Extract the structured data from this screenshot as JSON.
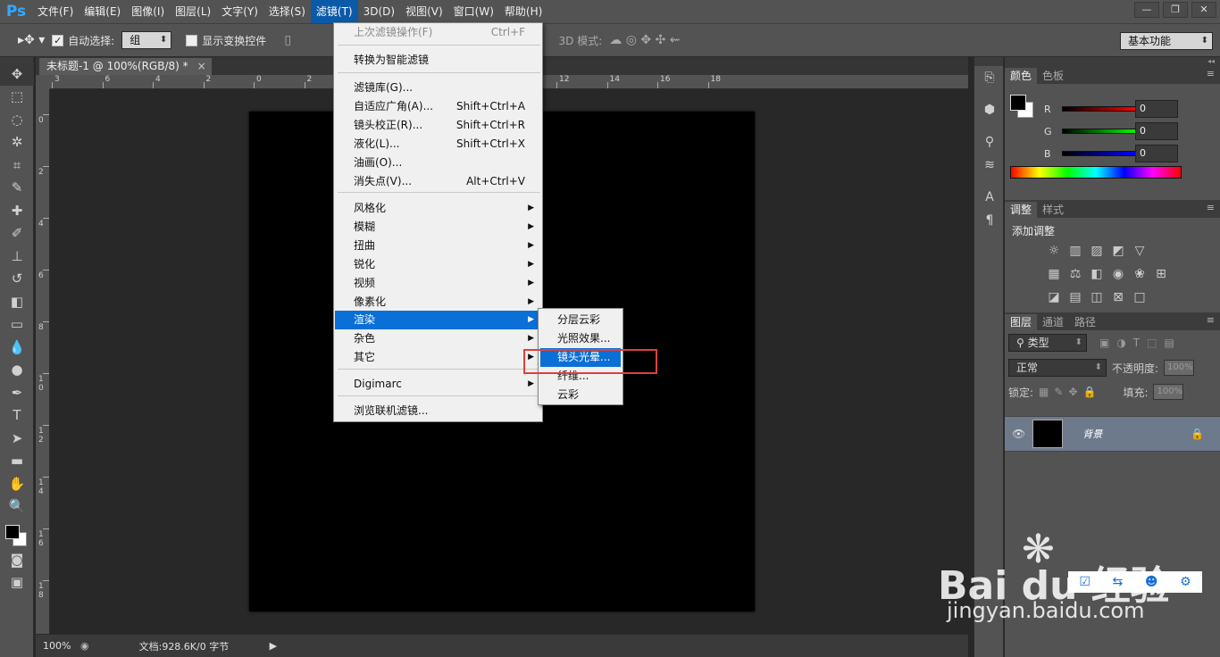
{
  "app": {
    "logo": "Ps"
  },
  "menubar": {
    "items": [
      "文件(F)",
      "编辑(E)",
      "图像(I)",
      "图层(L)",
      "文字(Y)",
      "选择(S)",
      "滤镜(T)",
      "3D(D)",
      "视图(V)",
      "窗口(W)",
      "帮助(H)"
    ],
    "active_index": 6,
    "window_controls": [
      "—",
      "❐",
      "✕"
    ]
  },
  "options": {
    "auto_select_label": "自动选择:",
    "auto_select_value": "组",
    "show_transform_label": "显示变换控件",
    "mode3d_label": "3D 模式:",
    "workspace": "基本功能"
  },
  "document": {
    "tab_title": "未标题-1 @ 100%(RGB/8) *",
    "close": "×",
    "ruler_top": [
      "3",
      "6",
      "4",
      "2",
      "0",
      "2",
      "4",
      "6",
      "8",
      "10",
      "12",
      "14",
      "16",
      "18"
    ],
    "ruler_left": [
      "0",
      "2",
      "4",
      "6",
      "8",
      "1\n0",
      "1\n2",
      "1\n4",
      "1\n6",
      "1\n8"
    ]
  },
  "status": {
    "zoom": "100%",
    "doc": "文档:928.6K/0 字节",
    "arrow": "▶"
  },
  "filter_menu": {
    "items": [
      {
        "label": "上次滤镜操作(F)",
        "shortcut": "Ctrl+F",
        "disabled": true
      },
      {
        "label": "转换为智能滤镜"
      },
      {
        "label": "滤镜库(G)..."
      },
      {
        "label": "自适应广角(A)...",
        "shortcut": "Shift+Ctrl+A"
      },
      {
        "label": "镜头校正(R)...",
        "shortcut": "Shift+Ctrl+R"
      },
      {
        "label": "液化(L)...",
        "shortcut": "Shift+Ctrl+X"
      },
      {
        "label": "油画(O)..."
      },
      {
        "label": "消失点(V)...",
        "shortcut": "Alt+Ctrl+V"
      },
      {
        "label": "风格化",
        "submenu": true
      },
      {
        "label": "模糊",
        "submenu": true
      },
      {
        "label": "扭曲",
        "submenu": true
      },
      {
        "label": "锐化",
        "submenu": true
      },
      {
        "label": "视频",
        "submenu": true
      },
      {
        "label": "像素化",
        "submenu": true
      },
      {
        "label": "渲染",
        "submenu": true,
        "highlighted": true
      },
      {
        "label": "杂色",
        "submenu": true
      },
      {
        "label": "其它",
        "submenu": true
      },
      {
        "label": "Digimarc",
        "submenu": true
      },
      {
        "label": "浏览联机滤镜..."
      }
    ]
  },
  "render_submenu": {
    "items": [
      "分层云彩",
      "光照效果...",
      "镜头光晕...",
      "纤维...",
      "云彩"
    ],
    "highlighted_index": 2
  },
  "panels": {
    "color_tabs": [
      "颜色",
      "色板"
    ],
    "rgb": [
      {
        "label": "R",
        "value": "0"
      },
      {
        "label": "G",
        "value": "0"
      },
      {
        "label": "B",
        "value": "0"
      }
    ],
    "adj_tabs": [
      "调整",
      "样式"
    ],
    "adj_title": "添加调整",
    "layer_tabs": [
      "图层",
      "通道",
      "路径"
    ],
    "kind": "类型",
    "blend": "正常",
    "opacity_label": "不透明度:",
    "opacity": "100%",
    "lock_label": "锁定:",
    "fill_label": "填充:",
    "fill": "100%",
    "layer_name": "背景"
  },
  "watermark": {
    "brand": "Bai  du 经验",
    "url": "jingyan.baidu.com"
  }
}
